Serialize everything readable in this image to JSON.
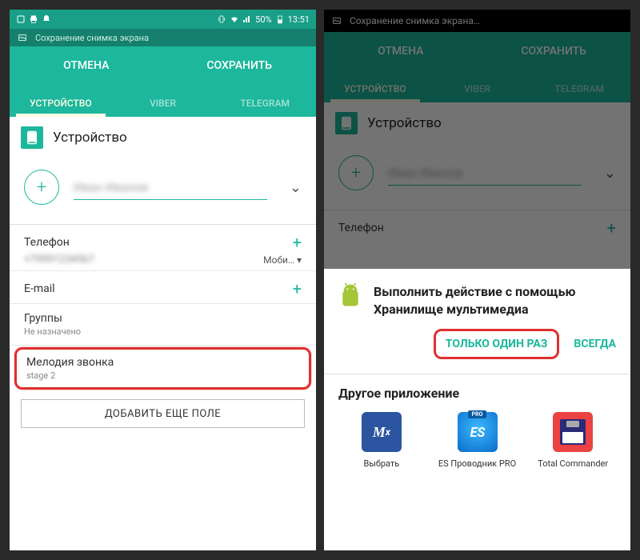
{
  "statusbar": {
    "time": "13:51",
    "battery": "50%"
  },
  "notification": {
    "text_left": "Сохранение снимка экрана",
    "text_right": "Сохранение снимка экрана…"
  },
  "topbar": {
    "cancel": "ОТМЕНА",
    "save": "СОХРАНИТЬ"
  },
  "tabs": {
    "device": "УСТРОЙСТВО",
    "viber": "VIBER",
    "telegram": "TELEGRAM"
  },
  "section": {
    "title": "Устройство"
  },
  "contact": {
    "name_blur": "Иван Иванов",
    "phone_label": "Телефон",
    "phone_value_blur": "+79991234567",
    "phone_type": "Моби…",
    "email_label": "E-mail",
    "groups_label": "Группы",
    "groups_value": "Не назначено",
    "ringtone_label": "Мелодия звонка",
    "ringtone_value": "stage 2",
    "add_field": "ДОБАВИТЬ ЕЩЕ ПОЛЕ"
  },
  "sheet": {
    "title": "Выполнить действие с помощью Хранилище мультимедиа",
    "just_once": "ТОЛЬКО ОДИН РАЗ",
    "always": "ВСЕГДА",
    "other_apps_title": "Другое приложение",
    "apps": [
      {
        "name": "Выбрать",
        "icon": "mx"
      },
      {
        "name": "ES Проводник PRO",
        "icon": "es"
      },
      {
        "name": "Total Commander",
        "icon": "tc"
      }
    ]
  }
}
